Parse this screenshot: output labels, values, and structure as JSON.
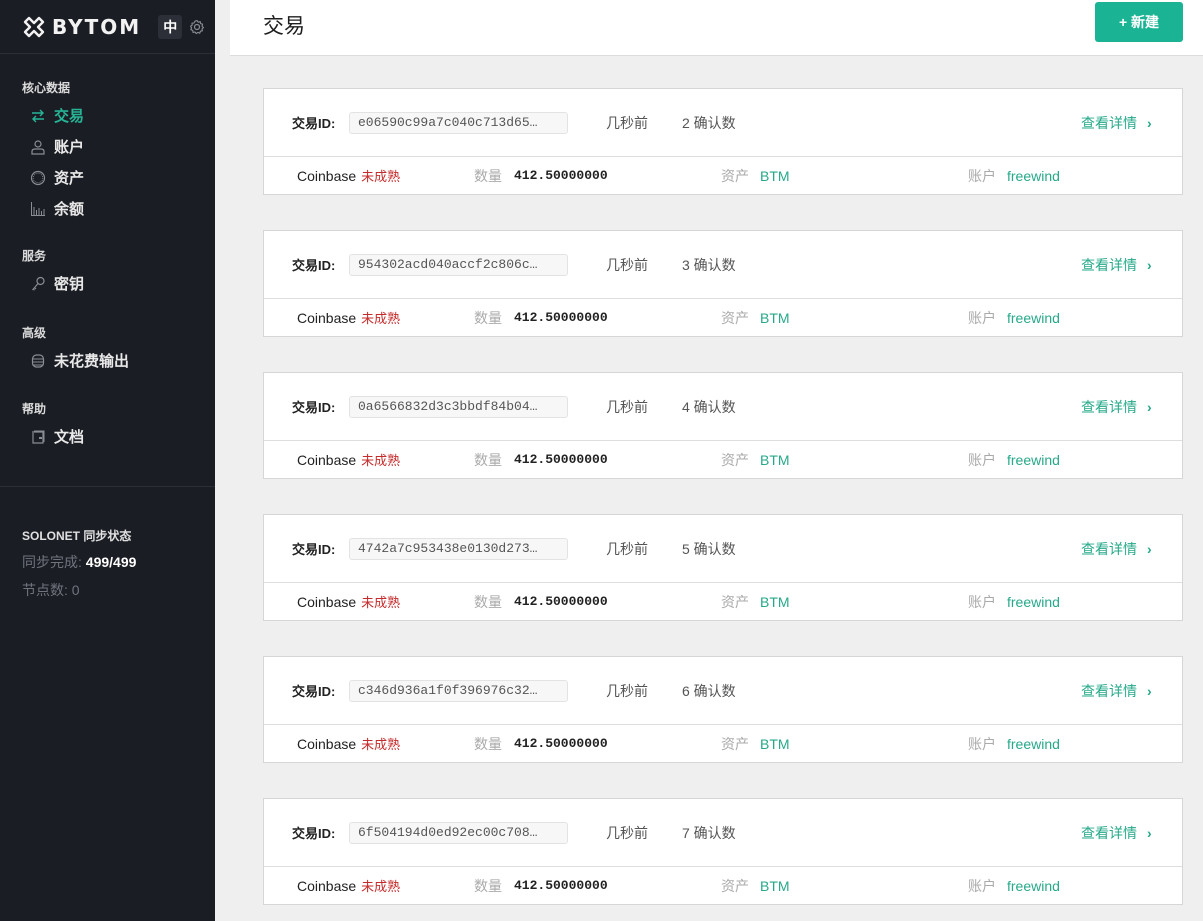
{
  "app": {
    "brand": "BYTOM",
    "language_toggle": "中",
    "settings_icon": "gear-icon"
  },
  "sidebar": {
    "sections": [
      {
        "heading": "核心数据",
        "items": [
          {
            "label": "交易",
            "icon": "transfer-arrows-icon",
            "active": true
          },
          {
            "label": "账户",
            "icon": "user-icon",
            "active": false
          },
          {
            "label": "资产",
            "icon": "circle-asset-icon",
            "active": false
          },
          {
            "label": "余额",
            "icon": "bar-chart-icon",
            "active": false
          }
        ]
      },
      {
        "heading": "服务",
        "items": [
          {
            "label": "密钥",
            "icon": "key-icon",
            "active": false
          }
        ]
      },
      {
        "heading": "高级",
        "items": [
          {
            "label": "未花费输出",
            "icon": "database-icon",
            "active": false
          }
        ]
      },
      {
        "heading": "帮助",
        "items": [
          {
            "label": "文档",
            "icon": "document-icon",
            "active": false
          }
        ]
      }
    ],
    "sync": {
      "title": "SOLONET 同步状态",
      "progress_label": "同步完成: ",
      "progress_value": "499/499",
      "nodes_label": "节点数: ",
      "nodes_value": "0"
    }
  },
  "header": {
    "title": "交易",
    "new_button": "+ 新建"
  },
  "colors": {
    "accent": "#1ab394",
    "link": "#26a98a",
    "immature": "#c62b2b",
    "sidebar_bg": "#1b1d24"
  },
  "transactions": [
    {
      "id_label": "交易ID:",
      "id": "e06590c99a7c040c713d65…",
      "time": "几秒前",
      "confirmations": "2 确认数",
      "details": "查看详情",
      "type": "Coinbase",
      "status": "未成熟",
      "amount_label": "数量",
      "amount": "412.50000000",
      "asset_label": "资产",
      "asset": "BTM",
      "account_label": "账户",
      "account": "freewind"
    },
    {
      "id_label": "交易ID:",
      "id": "954302acd040accf2c806c…",
      "time": "几秒前",
      "confirmations": "3 确认数",
      "details": "查看详情",
      "type": "Coinbase",
      "status": "未成熟",
      "amount_label": "数量",
      "amount": "412.50000000",
      "asset_label": "资产",
      "asset": "BTM",
      "account_label": "账户",
      "account": "freewind"
    },
    {
      "id_label": "交易ID:",
      "id": "0a6566832d3c3bbdf84b04…",
      "time": "几秒前",
      "confirmations": "4 确认数",
      "details": "查看详情",
      "type": "Coinbase",
      "status": "未成熟",
      "amount_label": "数量",
      "amount": "412.50000000",
      "asset_label": "资产",
      "asset": "BTM",
      "account_label": "账户",
      "account": "freewind"
    },
    {
      "id_label": "交易ID:",
      "id": "4742a7c953438e0130d273…",
      "time": "几秒前",
      "confirmations": "5 确认数",
      "details": "查看详情",
      "type": "Coinbase",
      "status": "未成熟",
      "amount_label": "数量",
      "amount": "412.50000000",
      "asset_label": "资产",
      "asset": "BTM",
      "account_label": "账户",
      "account": "freewind"
    },
    {
      "id_label": "交易ID:",
      "id": "c346d936a1f0f396976c32…",
      "time": "几秒前",
      "confirmations": "6 确认数",
      "details": "查看详情",
      "type": "Coinbase",
      "status": "未成熟",
      "amount_label": "数量",
      "amount": "412.50000000",
      "asset_label": "资产",
      "asset": "BTM",
      "account_label": "账户",
      "account": "freewind"
    },
    {
      "id_label": "交易ID:",
      "id": "6f504194d0ed92ec00c708…",
      "time": "几秒前",
      "confirmations": "7 确认数",
      "details": "查看详情",
      "type": "Coinbase",
      "status": "未成熟",
      "amount_label": "数量",
      "amount": "412.50000000",
      "asset_label": "资产",
      "asset": "BTM",
      "account_label": "账户",
      "account": "freewind"
    }
  ]
}
